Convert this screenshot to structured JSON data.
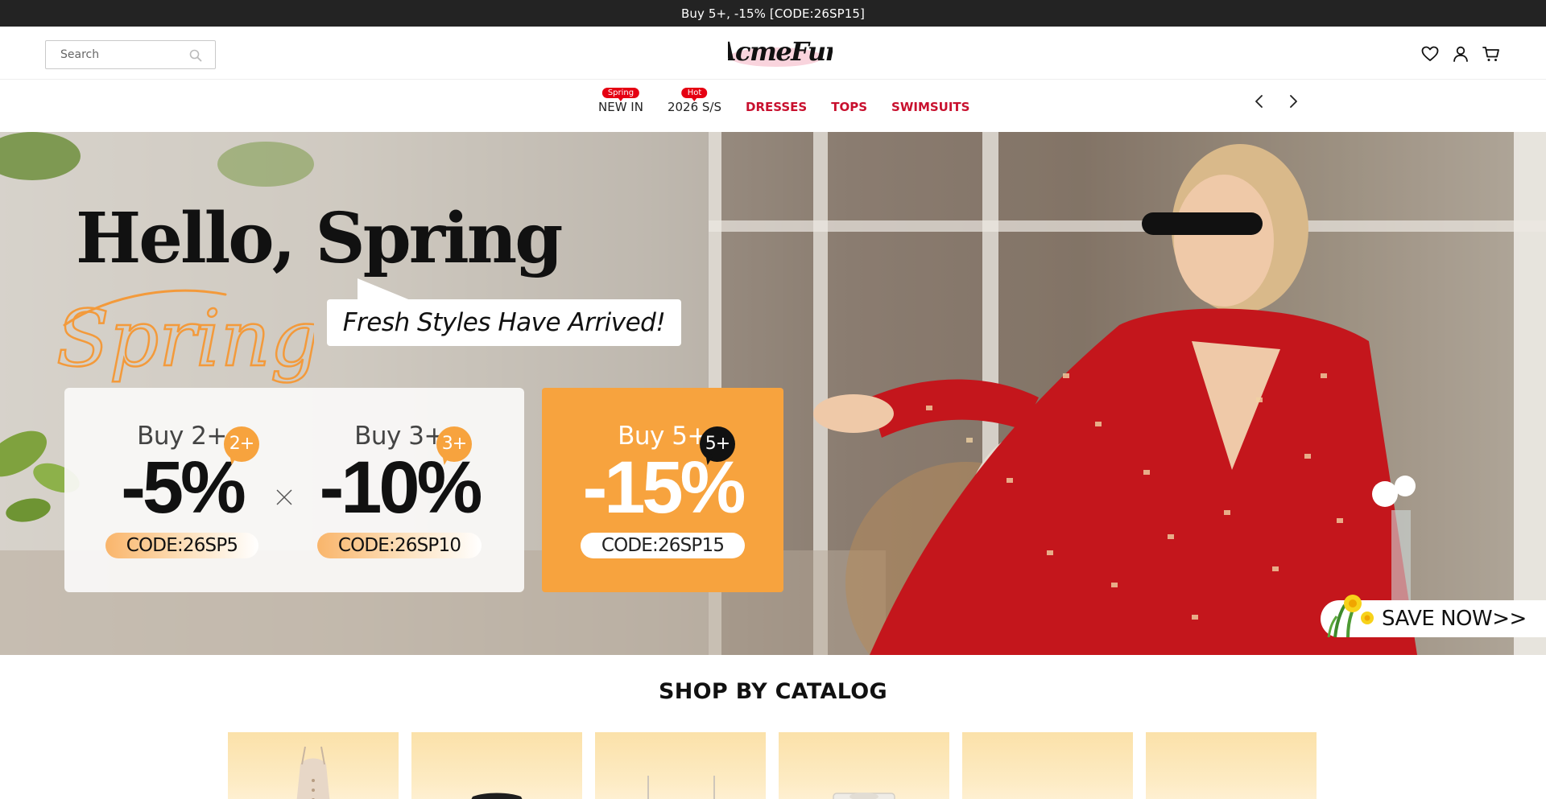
{
  "announcement": {
    "text": "Buy 5+, -15% [CODE:26SP15]"
  },
  "header": {
    "search": {
      "placeholder": "Search",
      "value": ""
    },
    "logo_text": "AcmeFun",
    "icons": [
      "heart-icon",
      "user-icon",
      "cart-icon"
    ]
  },
  "nav": {
    "items": [
      {
        "label": "NEW IN",
        "badge": "Spring",
        "style": "dark"
      },
      {
        "label": "2026 S/S",
        "badge": "Hot",
        "style": "dark"
      },
      {
        "label": "DRESSES",
        "badge": "",
        "style": "red"
      },
      {
        "label": "TOPS",
        "badge": "",
        "style": "red"
      },
      {
        "label": "SWIMSUITS",
        "badge": "",
        "style": "red"
      }
    ],
    "arrows": [
      "chevron-left-icon",
      "chevron-right-icon"
    ]
  },
  "hero": {
    "title": "Hello, Spring",
    "script_text": "Spring",
    "subtitle": "Fresh Styles Have Arrived!",
    "offers": [
      {
        "buy": "Buy 2+",
        "tag": "2+",
        "discount": "-5%",
        "code": "CODE:26SP5"
      },
      {
        "buy": "Buy 3+",
        "tag": "3+",
        "discount": "-10%",
        "code": "CODE:26SP10"
      },
      {
        "buy": "Buy 5+",
        "tag": "5+",
        "discount": "-15%",
        "code": "CODE:26SP15"
      }
    ],
    "cta": "SAVE NOW>>"
  },
  "catalog": {
    "title": "SHOP BY CATALOG",
    "count": 6
  },
  "colors": {
    "announcement_bg": "#232323",
    "nav_red": "#c8102e",
    "badge_red": "#e50012",
    "promo_orange": "#f7a33e",
    "catalog_card": "#fbe1a9"
  }
}
